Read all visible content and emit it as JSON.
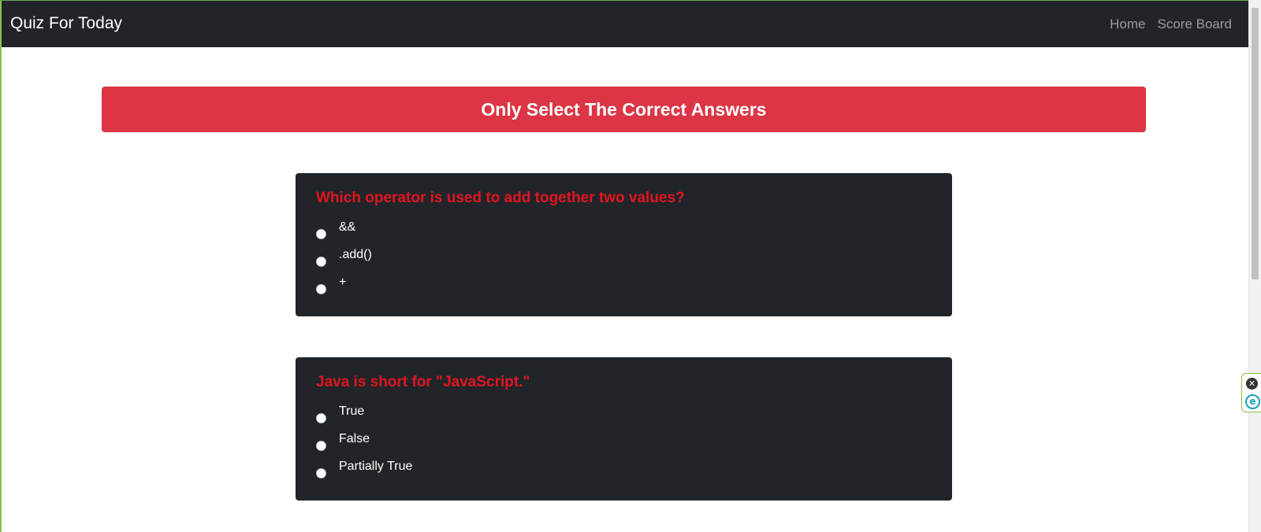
{
  "navbar": {
    "brand": "Quiz For Today",
    "links": [
      {
        "label": "Home"
      },
      {
        "label": "Score Board"
      }
    ]
  },
  "alert": {
    "text": "Only Select The Correct Answers",
    "color": "#dc3545"
  },
  "questions": [
    {
      "text": "Which operator is used to add together two values?",
      "options": [
        {
          "label": "&&"
        },
        {
          "label": ".add()"
        },
        {
          "label": "+"
        }
      ]
    },
    {
      "text": "Java is short for \"JavaScript.\"",
      "options": [
        {
          "label": "True"
        },
        {
          "label": "False"
        },
        {
          "label": "Partially True"
        }
      ]
    }
  ],
  "extension_widget": {
    "close_icon": "close-icon",
    "app_icon": "e-logo-icon"
  },
  "colors": {
    "navbar_bg": "#212529",
    "card_bg": "#212529",
    "question_text": "#e3141f",
    "alert_bg": "#dc3545"
  }
}
